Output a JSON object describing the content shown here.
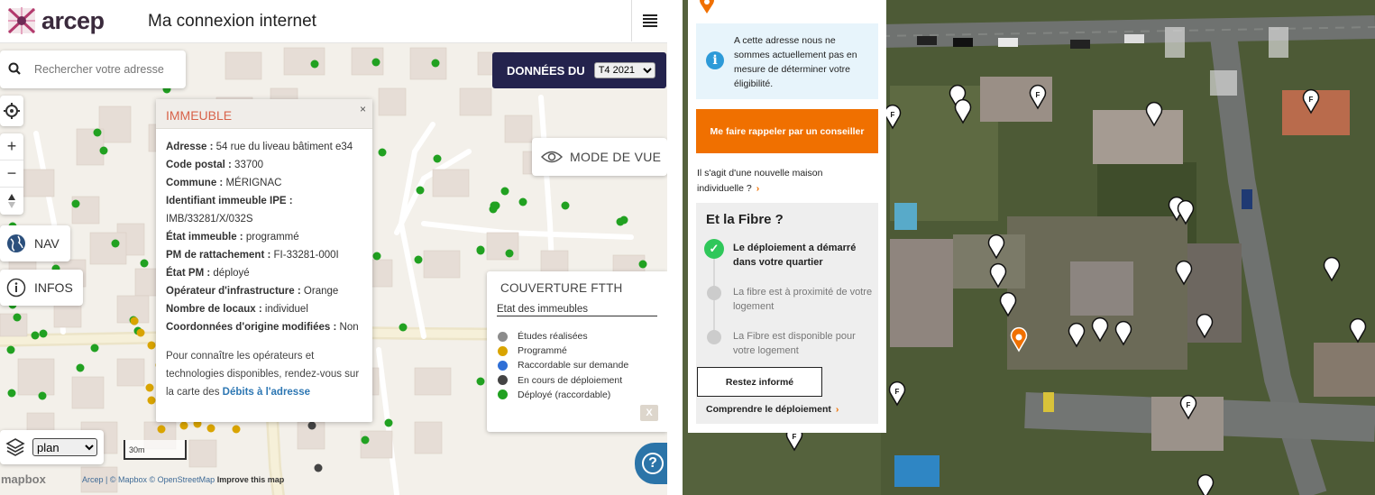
{
  "header": {
    "logo_text": "arcep",
    "title": "Ma connexion internet"
  },
  "search": {
    "placeholder": "Rechercher votre adresse"
  },
  "nav_label": "NAV",
  "infos_label": "INFOS",
  "data_selector": {
    "label": "DONNÉES DU",
    "value": "T4 2021",
    "options": [
      "T4 2021"
    ]
  },
  "view_mode_label": "MODE DE VUE",
  "popup": {
    "title": "IMMEUBLE",
    "close": "×",
    "fields": [
      {
        "label": "Adresse :",
        "value": "54 rue du liveau bâtiment e34"
      },
      {
        "label": "Code postal :",
        "value": "33700"
      },
      {
        "label": "Commune :",
        "value": "MÉRIGNAC"
      },
      {
        "label": "Identifiant immeuble IPE :",
        "value": ""
      },
      {
        "label": "",
        "value": "IMB/33281/X/032S"
      },
      {
        "label": "État immeuble :",
        "value": "programmé"
      },
      {
        "label": "PM de rattachement :",
        "value": "FI-33281-000I"
      },
      {
        "label": "État PM :",
        "value": "déployé"
      },
      {
        "label": "Opérateur d'infrastructure :",
        "value": "Orange"
      },
      {
        "label": "Nombre de locaux :",
        "value": "individuel"
      },
      {
        "label": "Coordonnées d'origine modifiées :",
        "value": "Non"
      }
    ],
    "footer_text": "Pour connaître les opérateurs et technologies disponibles, rendez-vous sur la carte des",
    "footer_link": "Débits à l'adresse"
  },
  "coverage": {
    "title": "COUVERTURE FTTH",
    "subtitle": "Etat des immeubles",
    "legend": [
      {
        "label": "Études réalisées",
        "color": "#8c8c8c"
      },
      {
        "label": "Programmé",
        "color": "#d9a400"
      },
      {
        "label": "Raccordable sur demande",
        "color": "#2f6fd6"
      },
      {
        "label": "En cours de déploiement",
        "color": "#444444"
      },
      {
        "label": "Déployé (raccordable)",
        "color": "#21a121"
      }
    ],
    "close": "X"
  },
  "layer_select": {
    "value": "plan",
    "options": [
      "plan"
    ]
  },
  "scale_label": "30m",
  "attribution": {
    "mapbox_logo": "mapbox",
    "text": "Arcep | © Mapbox © OpenStreetMap",
    "improve": "Improve this map"
  },
  "help_label": "?",
  "eligibility_panel": {
    "info_text": "A cette adresse nous ne sommes actuellement pas en mesure de déterminer votre éligibilité.",
    "callback_button": "Me faire rappeler par un conseiller",
    "new_house_text": "Il s'agit d'une nouvelle maison individuelle ?",
    "fibre_title": "Et la Fibre ?",
    "steps": [
      {
        "text": "Le déploiement a démarré dans votre quartier",
        "done": true
      },
      {
        "text": "La fibre est à proximité de votre logement",
        "done": false
      },
      {
        "text": "La Fibre est disponible pour votre logement",
        "done": false
      }
    ],
    "restez_button": "Restez informé",
    "comprendre_link": "Comprendre le déploiement",
    "arrow": "›",
    "pin_letter": "F"
  },
  "colors": {
    "navy": "#24234d",
    "orange": "#f07000",
    "popup_title": "#d8634a",
    "link_blue": "#2d77b3",
    "green_dot": "#21a121",
    "yellow_dot": "#d9a400"
  }
}
